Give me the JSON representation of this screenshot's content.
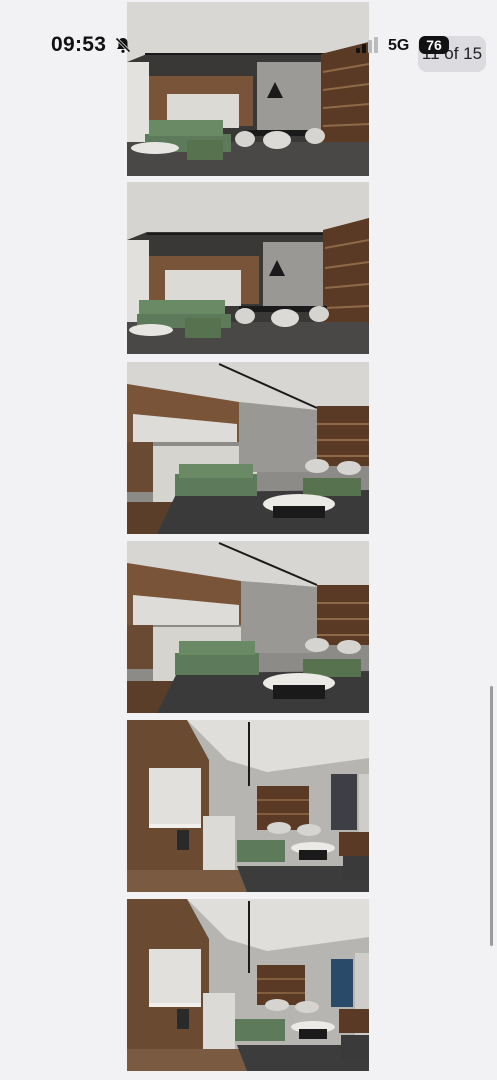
{
  "status_bar": {
    "time": "09:53",
    "network": "5G",
    "battery": "76",
    "icons": [
      "bell-slash-icon",
      "signal-bars-icon"
    ]
  },
  "viewer": {
    "page_counter": "11 of 15"
  },
  "gallery": {
    "thumbnails": [
      {
        "scene": "dining-and-living-wide"
      },
      {
        "scene": "dining-and-living-wide"
      },
      {
        "scene": "living-room-sofa"
      },
      {
        "scene": "living-room-sofa"
      },
      {
        "scene": "kitchen-corridor"
      },
      {
        "scene": "kitchen-corridor"
      }
    ]
  },
  "colors": {
    "background": "#f2f2f4",
    "wood": "#6b4a32",
    "sofa_green": "#5d7b5a",
    "ceiling": "#d8d6d2"
  }
}
